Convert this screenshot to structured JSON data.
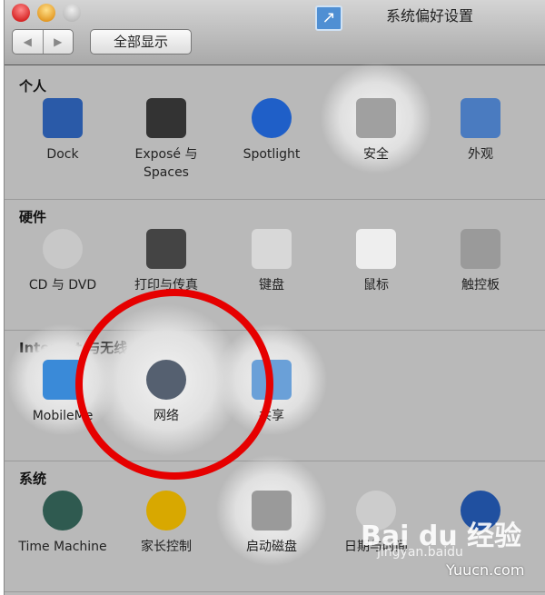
{
  "window": {
    "title": "系统偏好设置"
  },
  "toolbar": {
    "back": "◀",
    "forward": "▶",
    "show_all": "全部显示"
  },
  "sections": [
    {
      "title": "个人",
      "items": [
        {
          "label": "Dock",
          "icon": "dock-icon",
          "color": "#2a5aa8"
        },
        {
          "label": "Exposé 与 Spaces",
          "icon": "expose-icon",
          "color": "#333333"
        },
        {
          "label": "Spotlight",
          "icon": "spotlight-icon",
          "color": "#1f5fc8"
        },
        {
          "label": "安全",
          "icon": "security-house-icon",
          "color": "#a0a0a0"
        },
        {
          "label": "外观",
          "icon": "appearance-icon",
          "color": "#4a7bc0"
        }
      ]
    },
    {
      "title": "硬件",
      "items": [
        {
          "label": "CD 与 DVD",
          "icon": "cd-icon",
          "color": "#c8c8c8"
        },
        {
          "label": "打印与传真",
          "icon": "printer-icon",
          "color": "#444444"
        },
        {
          "label": "键盘",
          "icon": "keyboard-icon",
          "color": "#d8d8d8"
        },
        {
          "label": "鼠标",
          "icon": "mouse-icon",
          "color": "#eeeeee"
        },
        {
          "label": "触控板",
          "icon": "trackpad-icon",
          "color": "#9a9a9a"
        }
      ]
    },
    {
      "title": "Internet 与无线",
      "items": [
        {
          "label": "MobileMe",
          "icon": "mobileme-icon",
          "color": "#3a8ad8"
        },
        {
          "label": "网络",
          "icon": "network-globe-icon",
          "color": "#556070"
        },
        {
          "label": "共享",
          "icon": "sharing-folder-icon",
          "color": "#6aa0d8"
        }
      ]
    },
    {
      "title": "系统",
      "items": [
        {
          "label": "Time Machine",
          "icon": "time-machine-icon",
          "color": "#2f5a50"
        },
        {
          "label": "家长控制",
          "icon": "parental-controls-icon",
          "color": "#d8a800"
        },
        {
          "label": "启动磁盘",
          "icon": "startup-disk-icon",
          "color": "#9a9a9a"
        },
        {
          "label": "日期与时间",
          "icon": "clock-icon",
          "color": "#cccccc"
        },
        {
          "label": "",
          "icon": "universal-access-icon",
          "color": "#2050a0"
        }
      ]
    }
  ],
  "watermark": {
    "brand": "Bai du 经验",
    "sub": "jingyan.baidu",
    "site": "Yuucn.com"
  },
  "annotation": {
    "color": "#e60000"
  }
}
